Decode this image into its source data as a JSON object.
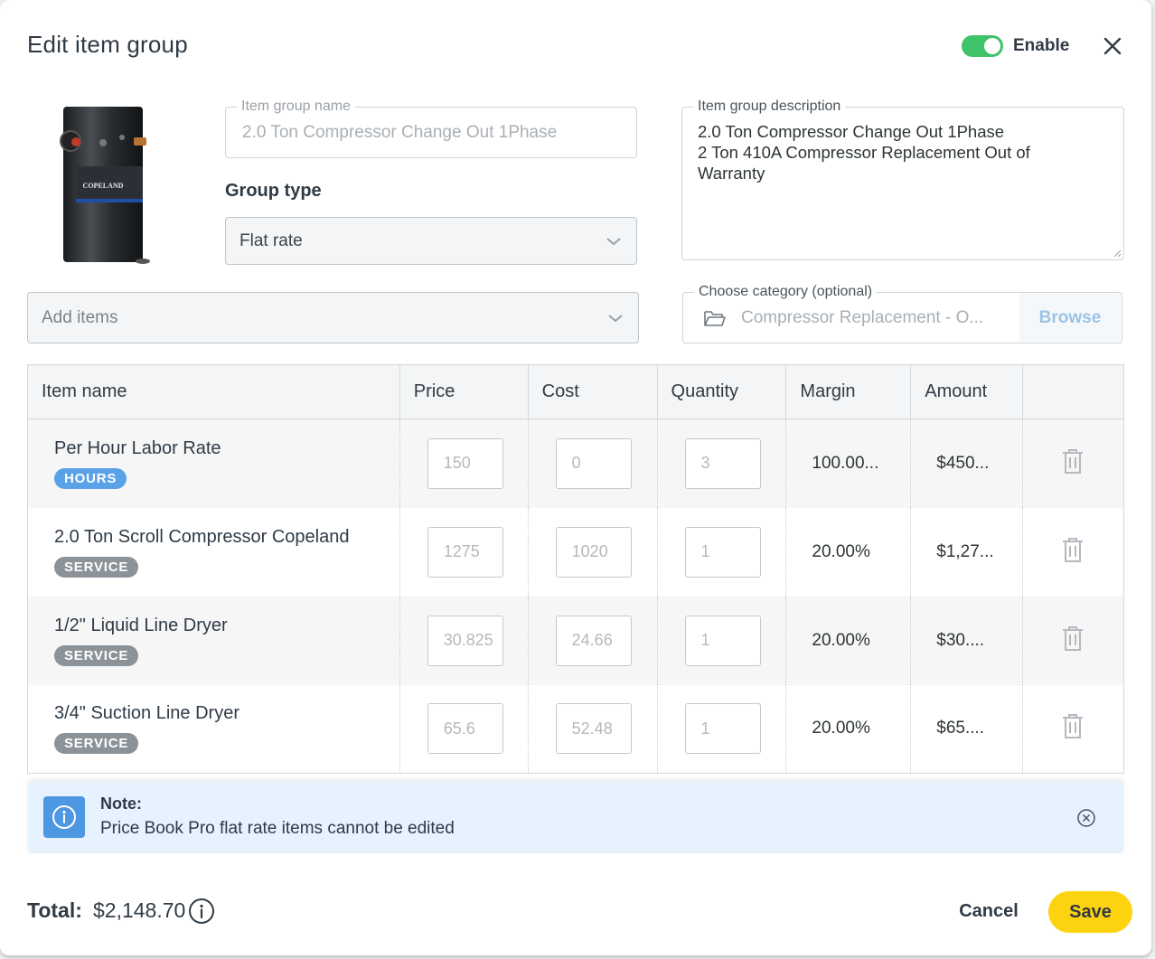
{
  "header": {
    "title": "Edit item group",
    "enable_label": "Enable",
    "enabled": true
  },
  "product_image": {
    "brand_label": "COPELAND"
  },
  "group_name": {
    "legend": "Item group name",
    "value": "2.0 Ton Compressor Change Out 1Phase"
  },
  "group_type": {
    "label": "Group type",
    "selected": "Flat rate"
  },
  "description": {
    "legend": "Item group description",
    "lines": [
      "2.0 Ton Compressor Change Out 1Phase",
      "2 Ton 410A Compressor Replacement Out of",
      "Warranty"
    ]
  },
  "add_items": {
    "placeholder": "Add items"
  },
  "category": {
    "legend": "Choose category (optional)",
    "value": "Compressor Replacement - O...",
    "browse_label": "Browse"
  },
  "table": {
    "columns": [
      "Item name",
      "Price",
      "Cost",
      "Quantity",
      "Margin",
      "Amount"
    ],
    "rows": [
      {
        "name": "Per Hour Labor Rate",
        "badge": "HOURS",
        "price": "150",
        "cost": "0",
        "quantity": "3",
        "margin": "100.00...",
        "amount": "$450..."
      },
      {
        "name": "2.0 Ton Scroll Compressor Copeland",
        "badge": "SERVICE",
        "price": "1275",
        "cost": "1020",
        "quantity": "1",
        "margin": "20.00%",
        "amount": "$1,27..."
      },
      {
        "name": "1/2\" Liquid Line Dryer",
        "badge": "SERVICE",
        "price": "30.825",
        "cost": "24.66",
        "quantity": "1",
        "margin": "20.00%",
        "amount": "$30...."
      },
      {
        "name": "3/4\" Suction Line Dryer",
        "badge": "SERVICE",
        "price": "65.6",
        "cost": "52.48",
        "quantity": "1",
        "margin": "20.00%",
        "amount": "$65...."
      }
    ]
  },
  "note": {
    "heading": "Note:",
    "message": "Price Book Pro flat rate items cannot be edited"
  },
  "footer": {
    "total_label": "Total:",
    "total_value": "$2,148.70",
    "cancel_label": "Cancel",
    "save_label": "Save"
  },
  "colors": {
    "toggle_on": "#3ec26a",
    "hours_badge": "#5aa2e8",
    "service_badge": "#8b9298",
    "note_bg": "#e6f2fd",
    "save_button": "#fdd30f"
  }
}
